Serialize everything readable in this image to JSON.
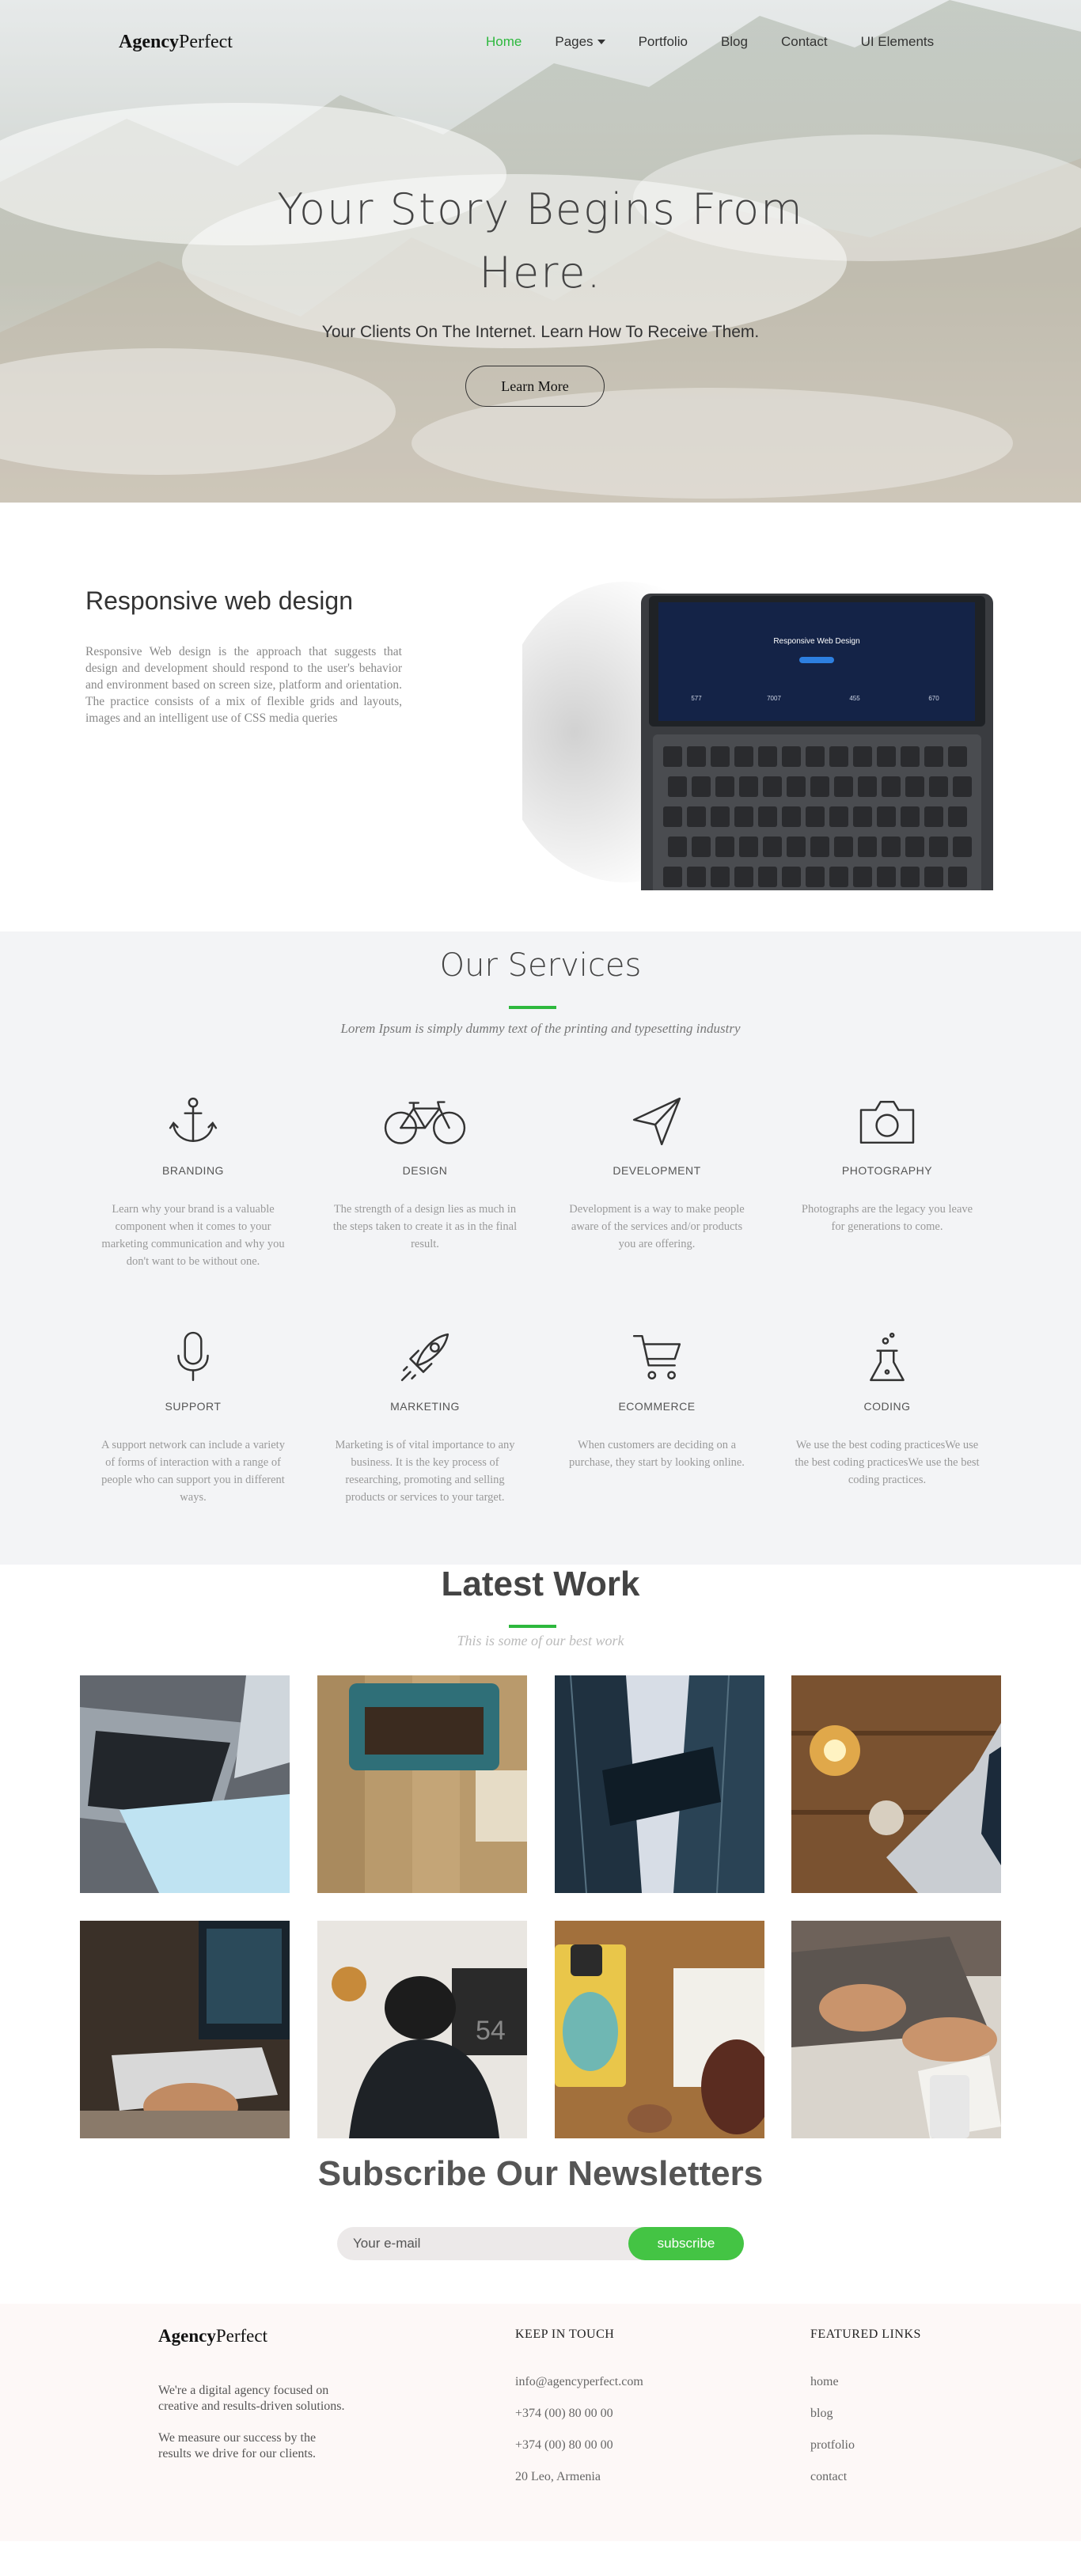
{
  "nav": {
    "logo_bold": "Agency",
    "logo_regular": "Perfect",
    "items": [
      {
        "label": "Home",
        "active": true
      },
      {
        "label": "Pages",
        "dropdown": true
      },
      {
        "label": "Portfolio"
      },
      {
        "label": "Blog"
      },
      {
        "label": "Contact"
      },
      {
        "label": "UI Elements"
      }
    ]
  },
  "hero": {
    "title_line1": "Your Story Begins From",
    "title_line2": "Here.",
    "subtitle": "Your Clients On The Internet. Learn How To Receive Them.",
    "button": "Learn More"
  },
  "responsive": {
    "title": "Responsive web design",
    "text": "Responsive Web design is the approach that suggests that design and development should respond to the user's behavior and environment based on screen size, platform and orientation. The practice consists of a mix of flexible grids and layouts, images and an intelligent use of CSS media queries",
    "screen_title": "Responsive Web Design",
    "screen_stats": [
      "577",
      "7007",
      "455",
      "670"
    ]
  },
  "services": {
    "title": "Our Services",
    "subtitle": "Lorem Ipsum is simply dummy text of the printing and typesetting industry",
    "items": [
      {
        "icon": "anchor-icon",
        "name": "BRANDING",
        "desc": "Learn why your brand is a valuable component when it comes to your marketing communication and why you don't want to be without one."
      },
      {
        "icon": "bicycle-icon",
        "name": "DESIGN",
        "desc": "The strength of a design lies as much in the steps taken to create it as in the final result."
      },
      {
        "icon": "paper-plane-icon",
        "name": "DEVELOPMENT",
        "desc": "Development is a way to make people aware of the services and/or products you are offering."
      },
      {
        "icon": "camera-icon",
        "name": "PHOTOGRAPHY",
        "desc": "Photographs are the legacy you leave for generations to come."
      },
      {
        "icon": "microphone-icon",
        "name": "SUPPORT",
        "desc": "A support network can include a variety of forms of interaction with a range of people who can support you in different ways."
      },
      {
        "icon": "rocket-icon",
        "name": "MARKETING",
        "desc": "Marketing is of vital importance to any business. It is the key process of researching, promoting and selling products or services to your target."
      },
      {
        "icon": "cart-icon",
        "name": "ECOMMERCE",
        "desc": "When customers are deciding on a purchase, they start by looking online."
      },
      {
        "icon": "flask-icon",
        "name": "CODING",
        "desc": "We use the best coding practicesWe use the best coding practicesWe use the best coding practices."
      }
    ]
  },
  "work": {
    "title": "Latest Work",
    "subtitle": "This is some of our best work",
    "jersey_number": "54"
  },
  "subscribe": {
    "title": "Subscribe Our Newsletters",
    "placeholder": "Your e-mail",
    "button": "subscribe"
  },
  "footer": {
    "logo_bold": "Agency",
    "logo_regular": "Perfect",
    "about1": "We're a digital agency focused on creative and results-driven solutions.",
    "about2": "We measure our success by the results we drive for our clients.",
    "contact_heading": "KEEP IN TOUCH",
    "contact": [
      "info@agencyperfect.com",
      "+374 (00) 80 00 00",
      "+374 (00) 80 00 00",
      "20 Leo, Armenia"
    ],
    "links_heading": "FEATURED LINKS",
    "links": [
      "home",
      "blog",
      "protfolio",
      "contact"
    ]
  },
  "colors": {
    "accent": "#2db83d",
    "subscribe_button": "#44c444",
    "services_bg": "#f3f4f6",
    "footer_bg": "#fdf8f7"
  }
}
